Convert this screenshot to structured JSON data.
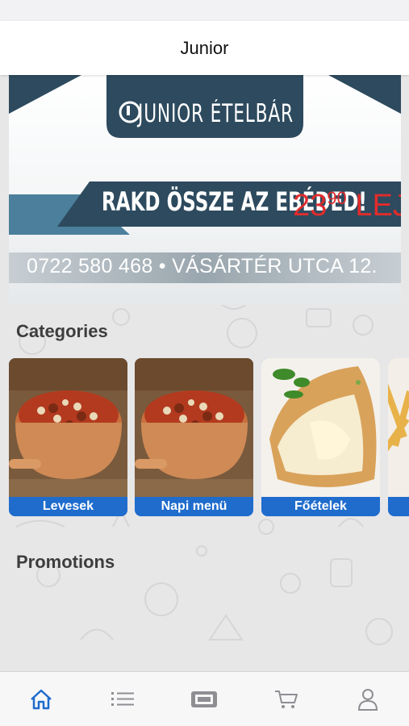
{
  "app": {
    "title": "Junior"
  },
  "banner": {
    "brand": "JUNIOR ÉTELBÁR",
    "slogan": "RAKD ÖSSZE AZ EBÉDED!",
    "price_main": "23",
    "price_cents": "90",
    "price_currency": "LEJ",
    "contact": "0722 580 468 • VÁSÁRTÉR UTCA 12."
  },
  "sections": {
    "categories": "Categories",
    "promotions": "Promotions"
  },
  "categories": [
    {
      "label": "Levesek",
      "image": "bean-stew-pot"
    },
    {
      "label": "Napi menü",
      "image": "bean-stew-pot"
    },
    {
      "label": "Főételek",
      "image": "cordon-bleu-cheese"
    },
    {
      "label": "",
      "image": "french-fries"
    }
  ],
  "tabbar": {
    "active_color": "#1f6ccd",
    "inactive_color": "#8e8e93",
    "items": [
      {
        "icon": "home-icon",
        "active": true
      },
      {
        "icon": "list-icon",
        "active": false
      },
      {
        "icon": "ticket-icon",
        "active": false
      },
      {
        "icon": "cart-icon",
        "active": false
      },
      {
        "icon": "profile-icon",
        "active": false
      }
    ]
  },
  "colors": {
    "brand_blue": "#1f6ccd",
    "banner_navy": "#2d4a5e",
    "price_red": "#e12c2c"
  }
}
